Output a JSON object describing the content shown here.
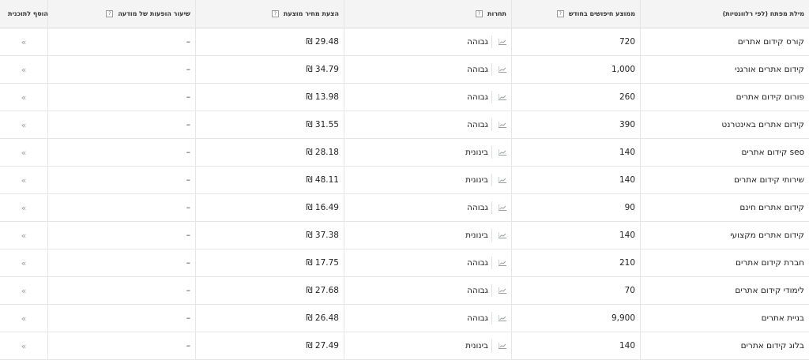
{
  "header": {
    "keyword": "מילת מפתח (לפי רלוונטיות)",
    "avg_searches": "ממוצע חיפושים בחודש",
    "competition": "תחרות",
    "suggested_bid": "הצעת מחיר מוצעת",
    "impression_share": "שיעור הופעות של מודעה",
    "add_to_plan": "הוסף לתוכנית",
    "help_glyph": "?"
  },
  "rows": [
    {
      "keyword": "קורס קידום אתרים",
      "avg": "720",
      "competition": "גבוהה",
      "bid": "₪ 29.48",
      "share": "–",
      "add": "«"
    },
    {
      "keyword": "קידום אתרים אורגני",
      "avg": "1,000",
      "competition": "גבוהה",
      "bid": "₪ 34.79",
      "share": "–",
      "add": "«"
    },
    {
      "keyword": "פורום קידום אתרים",
      "avg": "260",
      "competition": "גבוהה",
      "bid": "₪ 13.98",
      "share": "–",
      "add": "«"
    },
    {
      "keyword": "קידום אתרים באינטרנט",
      "avg": "390",
      "competition": "גבוהה",
      "bid": "₪ 31.55",
      "share": "–",
      "add": "«"
    },
    {
      "keyword": "קידום אתרים seo",
      "avg": "140",
      "competition": "בינונית",
      "bid": "₪ 28.18",
      "share": "–",
      "add": "«"
    },
    {
      "keyword": "שירותי קידום אתרים",
      "avg": "140",
      "competition": "בינונית",
      "bid": "₪ 48.11",
      "share": "–",
      "add": "«"
    },
    {
      "keyword": "קידום אתרים חינם",
      "avg": "90",
      "competition": "גבוהה",
      "bid": "₪ 16.49",
      "share": "–",
      "add": "«"
    },
    {
      "keyword": "קידום אתרים מקצועי",
      "avg": "140",
      "competition": "בינונית",
      "bid": "₪ 37.38",
      "share": "–",
      "add": "«"
    },
    {
      "keyword": "חברת קידום אתרים",
      "avg": "210",
      "competition": "גבוהה",
      "bid": "₪ 17.75",
      "share": "–",
      "add": "«"
    },
    {
      "keyword": "לימודי קידום אתרים",
      "avg": "70",
      "competition": "גבוהה",
      "bid": "₪ 27.68",
      "share": "–",
      "add": "«"
    },
    {
      "keyword": "בניית אתרים",
      "avg": "9,900",
      "competition": "גבוהה",
      "bid": "₪ 26.48",
      "share": "–",
      "add": "«"
    },
    {
      "keyword": "בלוג קידום אתרים",
      "avg": "140",
      "competition": "בינונית",
      "bid": "₪ 27.49",
      "share": "–",
      "add": "«"
    }
  ]
}
